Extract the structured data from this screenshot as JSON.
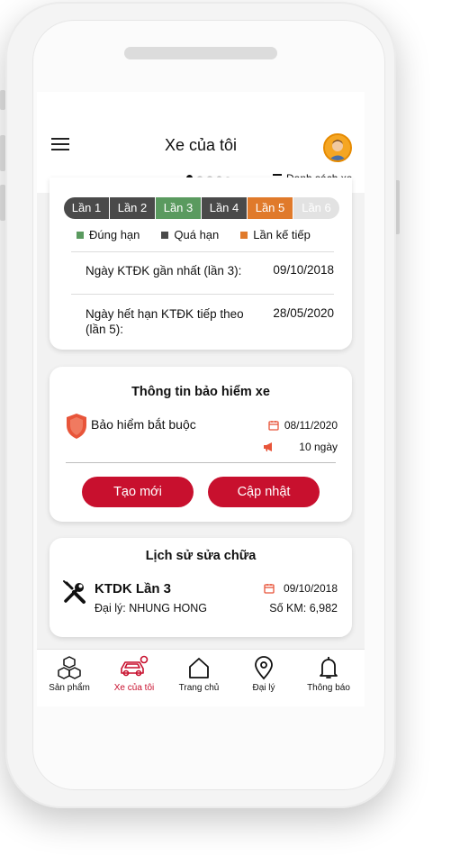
{
  "header": {
    "title": "Xe của tôi",
    "list_link": "Danh sách xe"
  },
  "carousel": {
    "pages": 5,
    "active_index": 0
  },
  "inspection": {
    "steps": [
      {
        "label": "Lần 1",
        "color": "#4a4a4a"
      },
      {
        "label": "Lần 2",
        "color": "#4a4a4a"
      },
      {
        "label": "Lần 3",
        "color": "#5a9a5f"
      },
      {
        "label": "Lần 4",
        "color": "#4a4a4a"
      },
      {
        "label": "Lần 5",
        "color": "#e07a2b"
      },
      {
        "label": "Lần 6",
        "color": "#e2e2e2"
      }
    ],
    "legend": [
      {
        "label": "Đúng hạn",
        "color": "#5a9a5f"
      },
      {
        "label": "Quá hạn",
        "color": "#4a4a4a"
      },
      {
        "label": "Lần kế tiếp",
        "color": "#e07a2b"
      }
    ],
    "last_label": "Ngày KTĐK gần nhất (lần 3):",
    "last_value": "09/10/2018",
    "next_label_1": "Ngày hết hạn KTĐK tiếp theo",
    "next_label_2": "(lần 5):",
    "next_value": "28/05/2020"
  },
  "insurance": {
    "title": "Thông tin bảo hiểm xe",
    "name": "Bảo hiểm bắt buộc",
    "date": "08/11/2020",
    "days": "10 ngày",
    "create_label": "Tạo mới",
    "update_label": "Cập nhật"
  },
  "repair": {
    "title": "Lịch sử sửa chữa",
    "name": "KTDK Lần 3",
    "dealer": "Đại lý: NHUNG HONG",
    "date": "09/10/2018",
    "km": "Số KM: 6,982"
  },
  "nav": [
    {
      "label": "Sản phẩm",
      "icon": "cubes-icon"
    },
    {
      "label": "Xe của tôi",
      "icon": "car-icon"
    },
    {
      "label": "Trang chủ",
      "icon": "home-icon"
    },
    {
      "label": "Đại lý",
      "icon": "location-pin-icon"
    },
    {
      "label": "Thông báo",
      "icon": "bell-icon"
    }
  ],
  "colors": {
    "accent": "#c8102e",
    "shield": "#e8553a"
  }
}
